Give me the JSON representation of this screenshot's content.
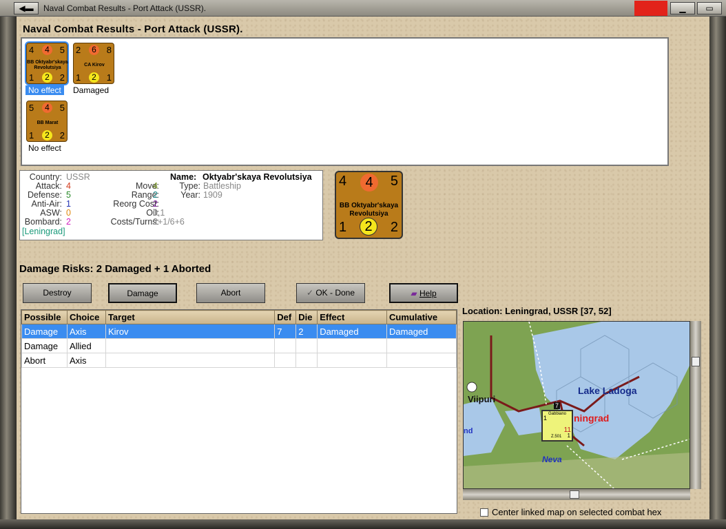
{
  "window": {
    "title": "Naval Combat Results - Port Attack (USSR)."
  },
  "heading": "Naval Combat Results - Port Attack (USSR).",
  "units": [
    {
      "tl": "4",
      "tc": "4",
      "tr": "5",
      "name1": "BB Oktyabr'skaya",
      "name2": "Revolutsiya",
      "bl": "1",
      "bc": "2",
      "br": "2",
      "label": "No effect",
      "selected": true
    },
    {
      "tl": "2",
      "tc": "6",
      "tr": "8",
      "name1": "CA Kirov",
      "name2": "",
      "bl": "1",
      "bc": "2",
      "br": "1",
      "label": "Damaged",
      "selected": false
    },
    {
      "tl": "5",
      "tc": "4",
      "tr": "5",
      "name1": "BB Marat",
      "name2": "",
      "bl": "1",
      "bc": "2",
      "br": "2",
      "label": "No effect",
      "selected": false
    }
  ],
  "stats": {
    "country_l": "Country:",
    "country_v": "USSR",
    "attack_l": "Attack:",
    "attack_v": "4",
    "defense_l": "Defense:",
    "defense_v": "5",
    "antiair_l": "Anti-Air:",
    "antiair_v": "1",
    "asw_l": "ASW:",
    "asw_v": "0",
    "bombard_l": "Bombard:",
    "bombard_v": "2",
    "location_v": "[Leningrad]",
    "move_l": "Move:",
    "move_v": "4",
    "range_l": "Range:",
    "range_v": "2",
    "reorg_l": "Reorg Cost:",
    "reorg_v": "2",
    "oil_l": "Oil:",
    "oil_v": "0,1",
    "costs_l": "Costs/Turns:",
    "costs_v": "2+1/6+6",
    "name_l": "Name:",
    "name_v": "Oktyabr'skaya Revolutsiya",
    "type_l": "Type:",
    "type_v": "Battleship",
    "year_l": "Year:",
    "year_v": "1909"
  },
  "bigunit": {
    "tl": "4",
    "tc": "4",
    "tr": "5",
    "name1": "BB Oktyabr'skaya",
    "name2": "Revolutsiya",
    "bl": "1",
    "bc": "2",
    "br": "2"
  },
  "risks": "Damage Risks:  2 Damaged + 1 Aborted",
  "buttons": {
    "destroy": "Destroy",
    "damage": "Damage",
    "abort": "Abort",
    "ok": "OK - Done",
    "help": "Help"
  },
  "table": {
    "headers": [
      "Possible",
      "Choice",
      "Target",
      "Def",
      "Die",
      "Effect",
      "Cumulative"
    ],
    "rows": [
      [
        "Damage",
        "Axis",
        "Kirov",
        "7",
        "2",
        "Damaged",
        "Damaged"
      ],
      [
        "Damage",
        "Allied",
        "",
        "",
        "",
        "",
        ""
      ],
      [
        "Abort",
        "Axis",
        "",
        "",
        "",
        "",
        ""
      ]
    ]
  },
  "location": "Location:  Leningrad, USSR [37, 52]",
  "map": {
    "lake": "Lake Ladoga",
    "city1": "Viipuri",
    "city2": "ningrad",
    "river": "Neva",
    "edge": "nd",
    "stack_top": "7",
    "stack_name": "Gabbiano",
    "stack_num": "11",
    "stack_id": "Z.501",
    "stack_l": "1",
    "stack_r": "1"
  },
  "checkbox": "Center linked map on selected combat hex",
  "colors": {
    "accent": "#3a8cf0",
    "counter": "#b97b1a",
    "attack": "#d23c1e",
    "defense": "#2a8a2a"
  }
}
